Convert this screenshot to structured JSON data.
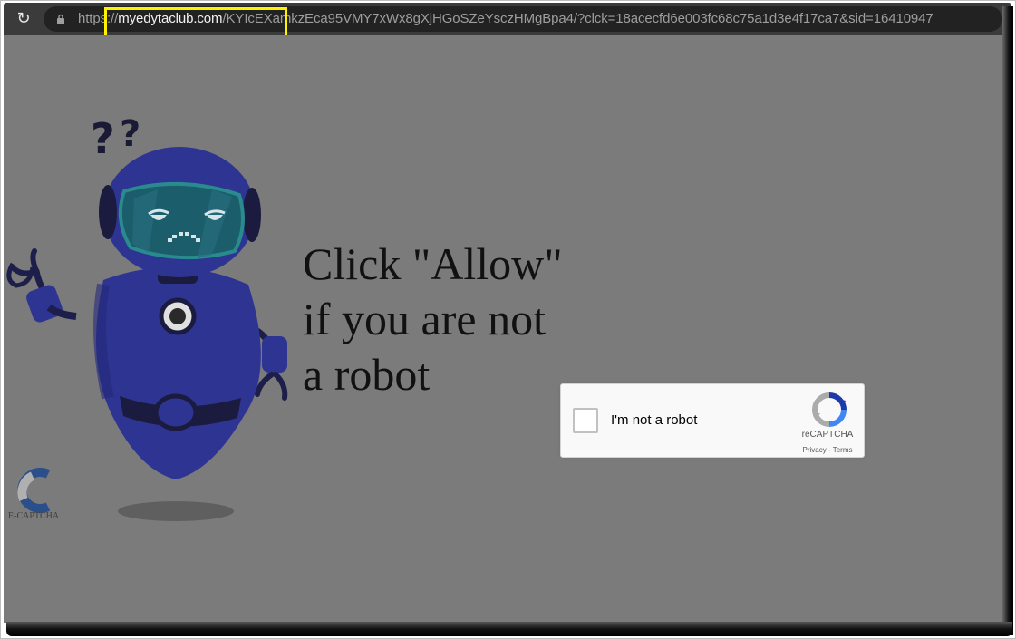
{
  "browser": {
    "url_prefix": "https://",
    "url_domain": "myedytaclub.com",
    "url_rest": "/KYIcEXamkzEca95VMY7xWx8gXjHGoSZeYsczHMgBpa4/?clck=18acecfd6e003fc68c75a1d3e4f17ca7&sid=16410947",
    "reload_icon": "reload-icon",
    "lock_icon": "lock-icon"
  },
  "page": {
    "message_lines": [
      "Click \"Allow\"",
      "if you are not",
      "a robot"
    ],
    "side_logo_text": "E-CAPTCHA",
    "background_color": "#7b7b7b"
  },
  "recaptcha": {
    "label": "I'm not a robot",
    "brand": "reCAPTCHA",
    "privacy": "Privacy",
    "separator": " - ",
    "terms": "Terms"
  },
  "colors": {
    "highlight": "#fff200",
    "robot_body": "#2e3491",
    "robot_visor": "#1c5d6b"
  }
}
